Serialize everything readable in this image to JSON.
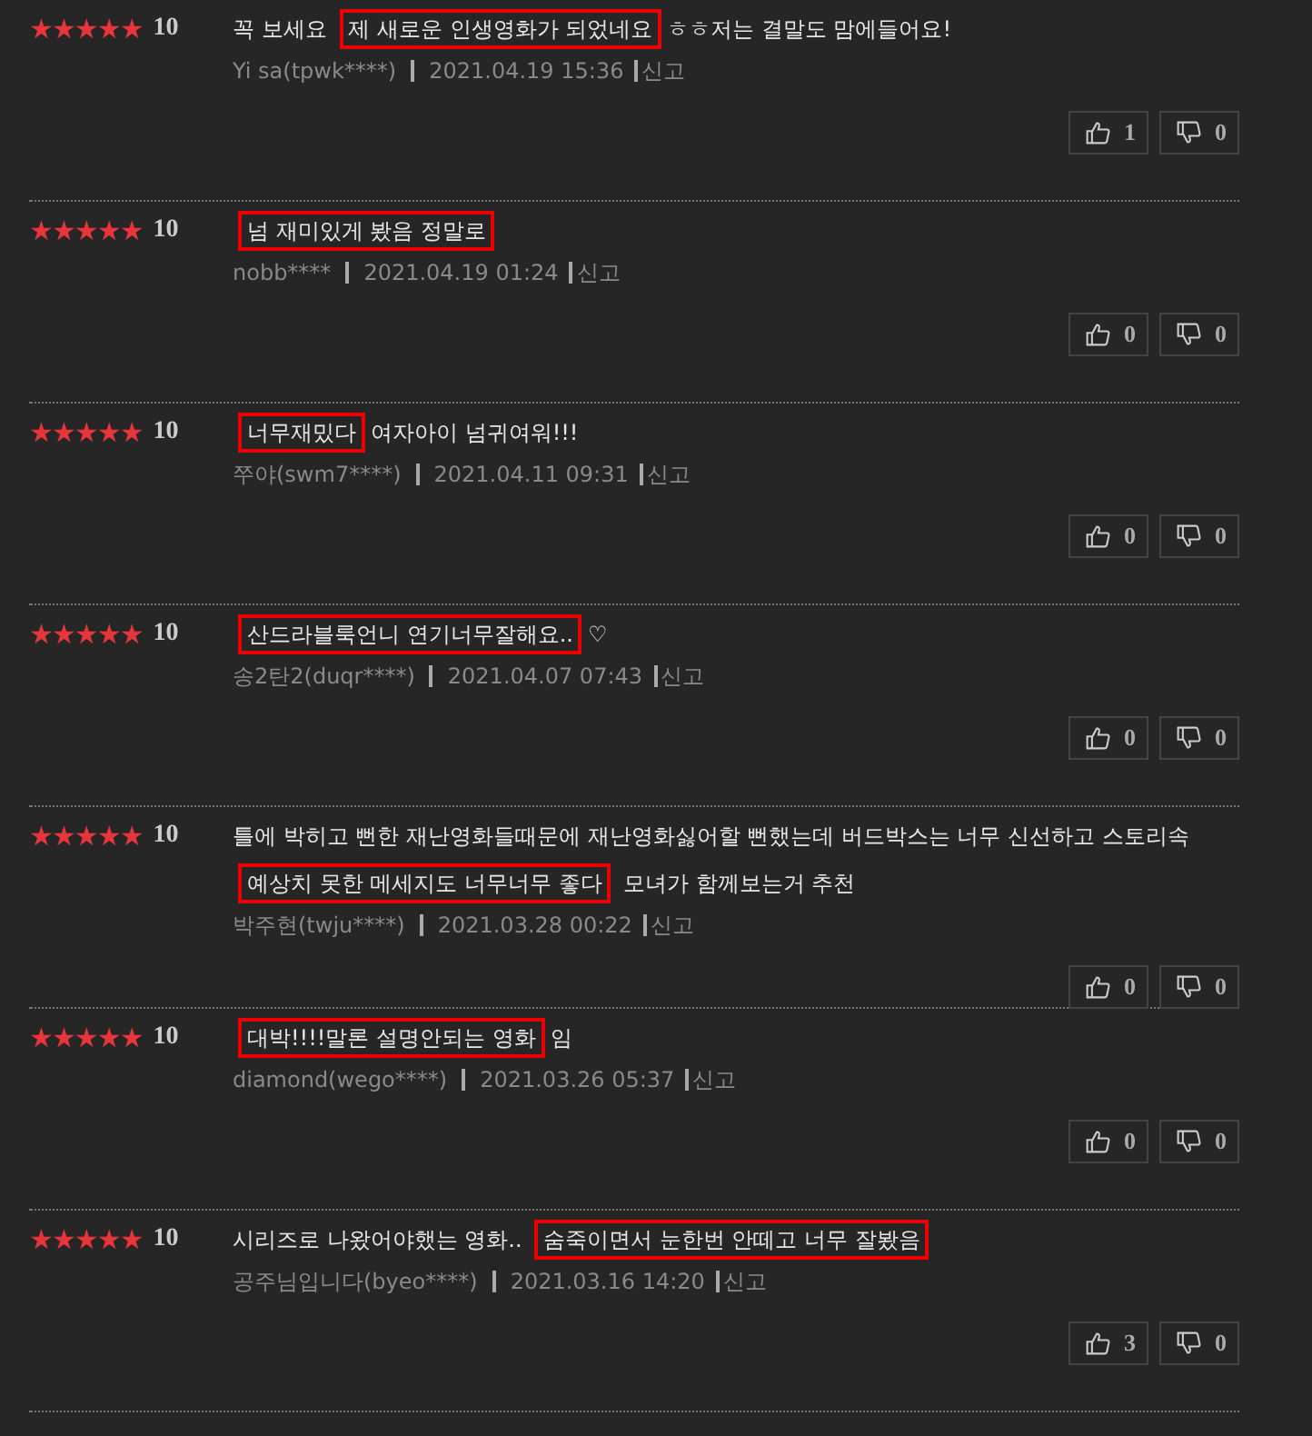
{
  "reviews": [
    {
      "stars": 5,
      "score": "10",
      "text": [
        {
          "text": "꼭 보세요 ",
          "highlighted": false
        },
        {
          "text": "제 새로운 인생영화가 되었네요",
          "highlighted": true
        },
        {
          "text": "ㅎㅎ저는 결말도 맘에들어요!",
          "highlighted": false
        }
      ],
      "author": "Yi sa(tpwk****)",
      "date": "2021.04.19 15:36",
      "report": "신고",
      "likes": "1",
      "dislikes": "0"
    },
    {
      "stars": 5,
      "score": "10",
      "text": [
        {
          "text": "넘 재미있게 봤음 정말로",
          "highlighted": true
        }
      ],
      "author": "nobb****",
      "date": "2021.04.19 01:24",
      "report": "신고",
      "likes": "0",
      "dislikes": "0"
    },
    {
      "stars": 5,
      "score": "10",
      "text": [
        {
          "text": "너무재밌다",
          "highlighted": true
        },
        {
          "text": "여자아이 넘귀여워!!!",
          "highlighted": false
        }
      ],
      "author": "쭈야(swm7****)",
      "date": "2021.04.11 09:31",
      "report": "신고",
      "likes": "0",
      "dislikes": "0"
    },
    {
      "stars": 5,
      "score": "10",
      "text": [
        {
          "text": "산드라블룩언니 연기너무잘해요..",
          "highlighted": true
        },
        {
          "text": "♡",
          "highlighted": false
        }
      ],
      "author": "송2탄2(duqr****)",
      "date": "2021.04.07 07:43",
      "report": "신고",
      "likes": "0",
      "dislikes": "0"
    },
    {
      "stars": 5,
      "score": "10",
      "text": [
        {
          "text": "틀에 박히고 뻔한 재난영화들때문에 재난영화싫어할 뻔했는데 버드박스는 너무 신선하고 스토리속 ",
          "highlighted": false
        },
        {
          "text": "예상치 못한 메세지도 너무너무 좋다",
          "highlighted": true
        },
        {
          "text": " 모녀가 함께보는거 추천",
          "highlighted": false
        }
      ],
      "author": "박주현(twju****)",
      "date": "2021.03.28 00:22",
      "report": "신고",
      "likes": "0",
      "dislikes": "0"
    },
    {
      "stars": 5,
      "score": "10",
      "text": [
        {
          "text": "대박!!!!말론 설명안되는 영화",
          "highlighted": true
        },
        {
          "text": "임",
          "highlighted": false
        }
      ],
      "author": "diamond(wego****)",
      "date": "2021.03.26 05:37",
      "report": "신고",
      "likes": "0",
      "dislikes": "0"
    },
    {
      "stars": 5,
      "score": "10",
      "text": [
        {
          "text": "시리즈로 나왔어야했는 영화.. ",
          "highlighted": false
        },
        {
          "text": "숨죽이면서 눈한번 안떼고 너무 잘봤음",
          "highlighted": true
        }
      ],
      "author": "공주님입니다(byeo****)",
      "date": "2021.03.16 14:20",
      "report": "신고",
      "likes": "3",
      "dislikes": "0"
    }
  ]
}
